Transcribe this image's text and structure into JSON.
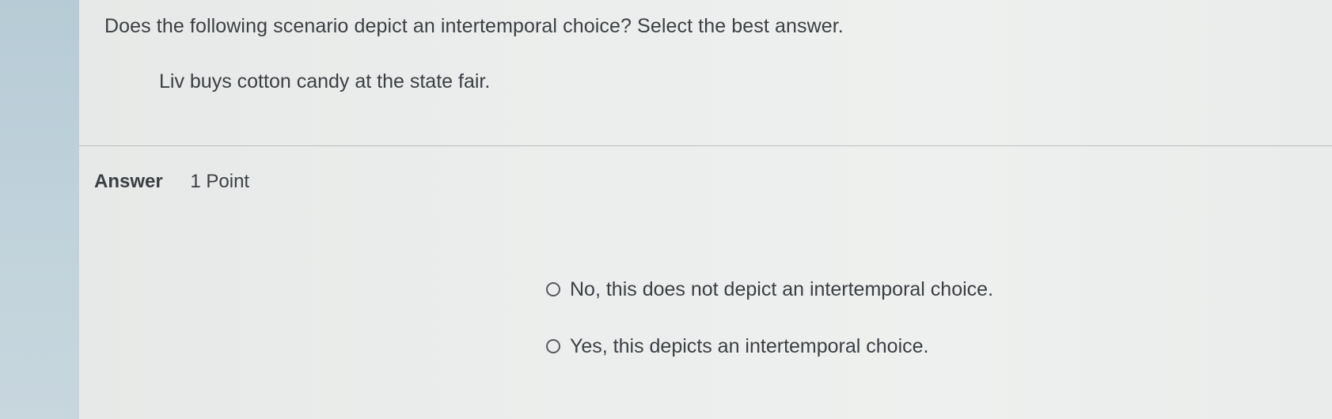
{
  "question": {
    "prompt": "Does the following scenario depict an intertemporal choice? Select the best answer.",
    "scenario": "Liv buys cotton candy at the state fair."
  },
  "answer": {
    "title": "Answer",
    "points": "1 Point",
    "options": [
      {
        "label": "No, this does not depict an intertemporal choice.",
        "selected": false
      },
      {
        "label": "Yes, this depicts an intertemporal choice.",
        "selected": false
      }
    ]
  }
}
